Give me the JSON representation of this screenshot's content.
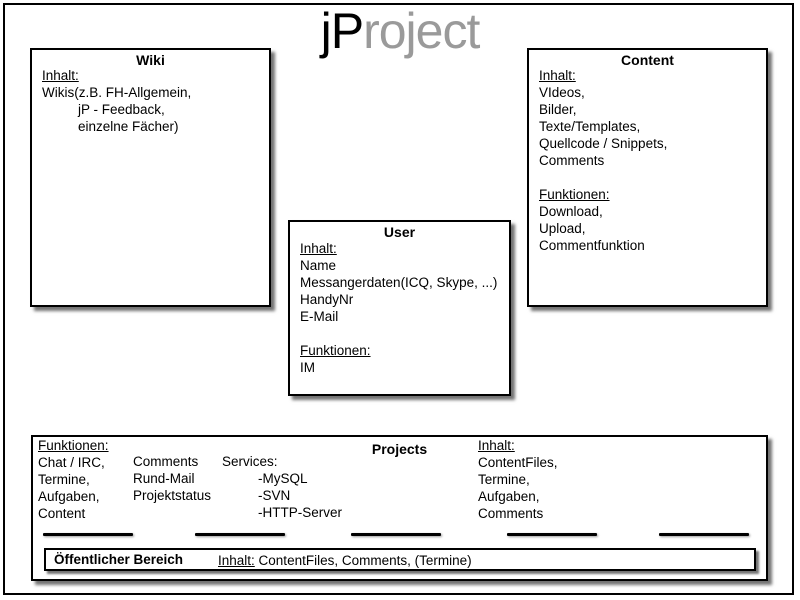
{
  "title": {
    "part1": "jP",
    "part2": "roject"
  },
  "wiki": {
    "title": "Wiki",
    "inhalt_label": "Inhalt:",
    "lines": [
      "Wikis(z.B. FH-Allgemein,",
      "jP - Feedback,",
      "einzelne Fächer)"
    ]
  },
  "content": {
    "title": "Content",
    "inhalt_label": "Inhalt:",
    "inhalt_lines": [
      "VIdeos,",
      "Bilder,",
      "Texte/Templates,",
      "Quellcode / Snippets,",
      "Comments"
    ],
    "funktionen_label": "Funktionen:",
    "funktionen_lines": [
      "Download,",
      "Upload,",
      "Commentfunktion"
    ]
  },
  "user": {
    "title": "User",
    "inhalt_label": "Inhalt:",
    "inhalt_lines": [
      "Name",
      "Messangerdaten(ICQ, Skype, ...)",
      "HandyNr",
      "E-Mail"
    ],
    "funktionen_label": "Funktionen:",
    "funktionen_lines": [
      "IM"
    ]
  },
  "projects": {
    "title": "Projects",
    "funktionen_label": "Funktionen:",
    "col1": [
      "Chat / IRC,",
      "Termine,",
      "Aufgaben,",
      "Content"
    ],
    "col2": [
      "Comments",
      "Rund-Mail",
      "Projektstatus"
    ],
    "services_label": "Services:",
    "services": [
      "-MySQL",
      "-SVN",
      "-HTTP-Server"
    ],
    "inhalt_label": "Inhalt:",
    "inhalt_lines": [
      "ContentFiles,",
      "Termine,",
      "Aufgaben,",
      "Comments"
    ]
  },
  "public_area": {
    "title": "Öffentlicher Bereich",
    "inhalt_label": "Inhalt:",
    "inhalt_text": "ContentFiles, Comments, (Termine)"
  }
}
